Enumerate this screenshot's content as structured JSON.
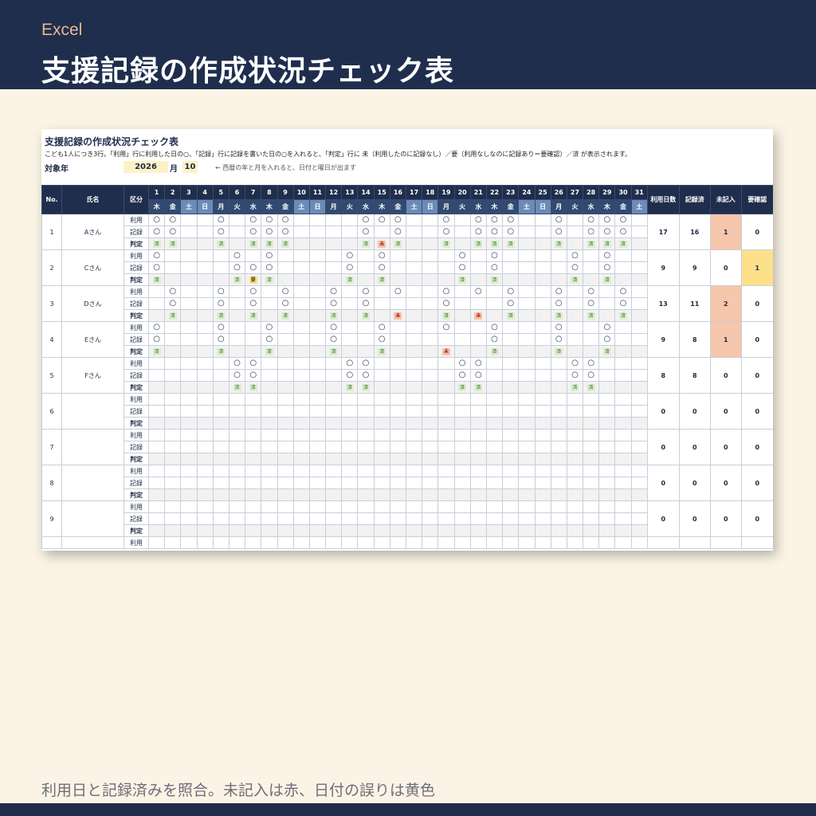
{
  "header": {
    "app": "Excel",
    "title": "支援記録の作成状況チェック表"
  },
  "caption": "利用日と記録済みを照合。未記入は赤、日付の誤りは黄色",
  "sheet": {
    "title": "支援記録の作成状況チェック表",
    "note": "こども1人につき3行。「利用」行に利用した日の○、「記録」行に記録を書いた日の○を入れると、「判定」行に 未（利用したのに記録なし）／要（利用なしなのに記録あり＝要確認）／済 が表示されます。",
    "target_label": "対象年",
    "year": "2026",
    "month_label": "月",
    "month": "10",
    "hint": "← 西暦の年と月を入れると、日付と曜日が出ます",
    "headers": {
      "no": "No.",
      "name": "氏名",
      "kubun": "区分",
      "use_days": "利用日数",
      "recorded": "記録済",
      "missing": "未記入",
      "check": "要確認"
    },
    "kubun_labels": [
      "利用",
      "記録",
      "判定"
    ],
    "mark_symbol": "○",
    "judge_labels": {
      "ok": "済",
      "missing": "未",
      "check": "要"
    },
    "days": [
      {
        "d": "1",
        "w": "木"
      },
      {
        "d": "2",
        "w": "金"
      },
      {
        "d": "3",
        "w": "土"
      },
      {
        "d": "4",
        "w": "日"
      },
      {
        "d": "5",
        "w": "月"
      },
      {
        "d": "6",
        "w": "火"
      },
      {
        "d": "7",
        "w": "水"
      },
      {
        "d": "8",
        "w": "木"
      },
      {
        "d": "9",
        "w": "金"
      },
      {
        "d": "10",
        "w": "土"
      },
      {
        "d": "11",
        "w": "日"
      },
      {
        "d": "12",
        "w": "月"
      },
      {
        "d": "13",
        "w": "火"
      },
      {
        "d": "14",
        "w": "水"
      },
      {
        "d": "15",
        "w": "木"
      },
      {
        "d": "16",
        "w": "金"
      },
      {
        "d": "17",
        "w": "土"
      },
      {
        "d": "18",
        "w": "日"
      },
      {
        "d": "19",
        "w": "月"
      },
      {
        "d": "20",
        "w": "火"
      },
      {
        "d": "21",
        "w": "水"
      },
      {
        "d": "22",
        "w": "木"
      },
      {
        "d": "23",
        "w": "金"
      },
      {
        "d": "24",
        "w": "土"
      },
      {
        "d": "25",
        "w": "日"
      },
      {
        "d": "26",
        "w": "月"
      },
      {
        "d": "27",
        "w": "火"
      },
      {
        "d": "28",
        "w": "水"
      },
      {
        "d": "29",
        "w": "木"
      },
      {
        "d": "30",
        "w": "金"
      },
      {
        "d": "31",
        "w": "土"
      }
    ],
    "rows": [
      {
        "no": "1",
        "name": "Aさん",
        "use": [
          1,
          2,
          5,
          7,
          8,
          9,
          14,
          15,
          16,
          19,
          21,
          22,
          23,
          26,
          28,
          29,
          30
        ],
        "rec": [
          1,
          2,
          5,
          7,
          8,
          9,
          14,
          16,
          19,
          21,
          22,
          23,
          26,
          28,
          29,
          30
        ],
        "judge": {
          "1": "済",
          "2": "済",
          "5": "済",
          "7": "済",
          "8": "済",
          "9": "済",
          "14": "済",
          "15": "未",
          "16": "済",
          "19": "済",
          "21": "済",
          "22": "済",
          "23": "済",
          "26": "済",
          "28": "済",
          "29": "済",
          "30": "済"
        },
        "totals": {
          "use": "17",
          "rec": "16",
          "missing": "1",
          "check": "0"
        }
      },
      {
        "no": "2",
        "name": "Cさん",
        "use": [
          1,
          6,
          8,
          13,
          15,
          20,
          22,
          27,
          29
        ],
        "rec": [
          1,
          6,
          7,
          8,
          13,
          15,
          20,
          22,
          27,
          29
        ],
        "judge": {
          "1": "済",
          "6": "済",
          "7": "要",
          "8": "済",
          "13": "済",
          "15": "済",
          "20": "済",
          "22": "済",
          "27": "済",
          "29": "済"
        },
        "totals": {
          "use": "9",
          "rec": "9",
          "missing": "0",
          "check": "1"
        }
      },
      {
        "no": "3",
        "name": "Dさん",
        "use": [
          2,
          5,
          7,
          9,
          12,
          14,
          16,
          19,
          21,
          23,
          26,
          28,
          30
        ],
        "rec": [
          2,
          5,
          7,
          9,
          12,
          14,
          19,
          23,
          26,
          28,
          30
        ],
        "judge": {
          "2": "済",
          "5": "済",
          "7": "済",
          "9": "済",
          "12": "済",
          "14": "済",
          "16": "未",
          "19": "済",
          "21": "未",
          "23": "済",
          "26": "済",
          "28": "済",
          "30": "済"
        },
        "totals": {
          "use": "13",
          "rec": "11",
          "missing": "2",
          "check": "0"
        }
      },
      {
        "no": "4",
        "name": "Eさん",
        "use": [
          1,
          5,
          8,
          12,
          15,
          19,
          22,
          26,
          29
        ],
        "rec": [
          1,
          5,
          8,
          12,
          15,
          22,
          26,
          29
        ],
        "judge": {
          "1": "済",
          "5": "済",
          "8": "済",
          "12": "済",
          "15": "済",
          "19": "未",
          "22": "済",
          "26": "済",
          "29": "済"
        },
        "totals": {
          "use": "9",
          "rec": "8",
          "missing": "1",
          "check": "0"
        }
      },
      {
        "no": "5",
        "name": "Fさん",
        "use": [
          6,
          7,
          13,
          14,
          20,
          21,
          27,
          28
        ],
        "rec": [
          6,
          7,
          13,
          14,
          20,
          21,
          27,
          28
        ],
        "judge": {
          "6": "済",
          "7": "済",
          "13": "済",
          "14": "済",
          "20": "済",
          "21": "済",
          "27": "済",
          "28": "済"
        },
        "totals": {
          "use": "8",
          "rec": "8",
          "missing": "0",
          "check": "0"
        }
      },
      {
        "no": "6",
        "name": "",
        "use": [],
        "rec": [],
        "judge": {},
        "totals": {
          "use": "0",
          "rec": "0",
          "missing": "0",
          "check": "0"
        }
      },
      {
        "no": "7",
        "name": "",
        "use": [],
        "rec": [],
        "judge": {},
        "totals": {
          "use": "0",
          "rec": "0",
          "missing": "0",
          "check": "0"
        }
      },
      {
        "no": "8",
        "name": "",
        "use": [],
        "rec": [],
        "judge": {},
        "totals": {
          "use": "0",
          "rec": "0",
          "missing": "0",
          "check": "0"
        }
      },
      {
        "no": "9",
        "name": "",
        "use": [],
        "rec": [],
        "judge": {},
        "totals": {
          "use": "0",
          "rec": "0",
          "missing": "0",
          "check": "0"
        }
      },
      {
        "no": "",
        "name": "",
        "use": [],
        "rec": [],
        "judge": {},
        "totals": {
          "use": "",
          "rec": "",
          "missing": "",
          "check": ""
        }
      }
    ],
    "colors": {
      "header": "#1f2e4d",
      "weekend": "#6b8bb8",
      "missing": "#f6c6ad",
      "check": "#fde08a",
      "ok": "#ddeecf"
    }
  }
}
